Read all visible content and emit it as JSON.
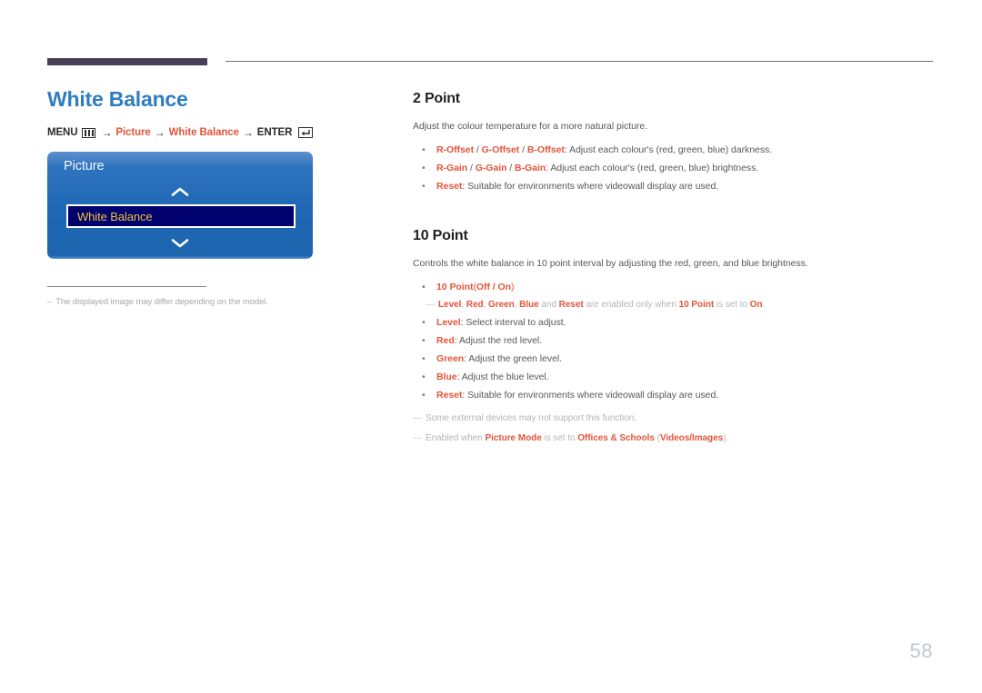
{
  "header": {
    "accent_bar_color": "#474058",
    "rule_color": "#6e6e6e"
  },
  "left": {
    "title": "White Balance",
    "menu_path": {
      "menu_label": "MENU",
      "menu_icon": "menu-grid-icon",
      "arrow": "→",
      "item1": "Picture",
      "item2": "White Balance",
      "enter_label": "ENTER",
      "enter_icon": "enter-return-icon"
    },
    "osd": {
      "title": "Picture",
      "chevron_up_icon": "chevron-up-icon",
      "chevron_down_icon": "chevron-down-icon",
      "selected_item": "White Balance",
      "selected_bg": "#00006e",
      "selected_text_color": "#f0c43c",
      "panel_blue": "#1f67b4"
    },
    "note": {
      "dash": "–",
      "text": "The displayed image may differ depending on the model."
    }
  },
  "right": {
    "section1": {
      "heading": "2 Point",
      "intro": "Adjust the colour temperature for a more natural picture.",
      "bullets": [
        {
          "key_parts": [
            "R-Offset",
            "G-Offset",
            "B-Offset"
          ],
          "separator": " / ",
          "rest": ": Adjust each colour's (red, green, blue) darkness."
        },
        {
          "key_parts": [
            "R-Gain",
            "G-Gain",
            "B-Gain"
          ],
          "separator": " / ",
          "rest": ": Adjust each colour's (red, green, blue) brightness."
        },
        {
          "key_parts": [
            "Reset"
          ],
          "separator": "",
          "rest": ": Suitable for environments where videowall display are used."
        }
      ]
    },
    "section2": {
      "heading": "10 Point",
      "intro": "Controls the white balance in 10 point interval by adjusting the red, green, and blue brightness.",
      "option_bullet": {
        "name": "10 Point",
        "values_open": "(",
        "values": "Off / On",
        "values_close": ")"
      },
      "subnote": {
        "dash": "—",
        "kw1": "Level",
        "kw2": "Red",
        "kw3": "Green",
        "kw4": "Blue",
        "mid": " and ",
        "kw5": "Reset",
        "tail1": " are enabled only when ",
        "kw6": "10 Point",
        "tail2": " is set to ",
        "kw7": "On",
        "tail3": "."
      },
      "bullets": [
        {
          "key": "Level",
          "rest": ": Select interval to adjust."
        },
        {
          "key": "Red",
          "rest": ": Adjust the red level."
        },
        {
          "key": "Green",
          "rest": ": Adjust the green level."
        },
        {
          "key": "Blue",
          "rest": ": Adjust the blue level."
        },
        {
          "key": "Reset",
          "rest": ": Suitable for environments where videowall display are used."
        }
      ],
      "footnotes": [
        {
          "dash": "—",
          "pre": "Some external devices may not support this function.",
          "kw1": "",
          "mid": "",
          "kw2": "",
          "tail": ""
        },
        {
          "dash": "—",
          "pre": "Enabled when ",
          "kw1": "Picture Mode",
          "mid": " is set to ",
          "kw2": "Offices & Schools",
          "paren_open": " (",
          "kw3": "Videos/Images",
          "tail": ")."
        }
      ]
    }
  },
  "page_number": "58"
}
